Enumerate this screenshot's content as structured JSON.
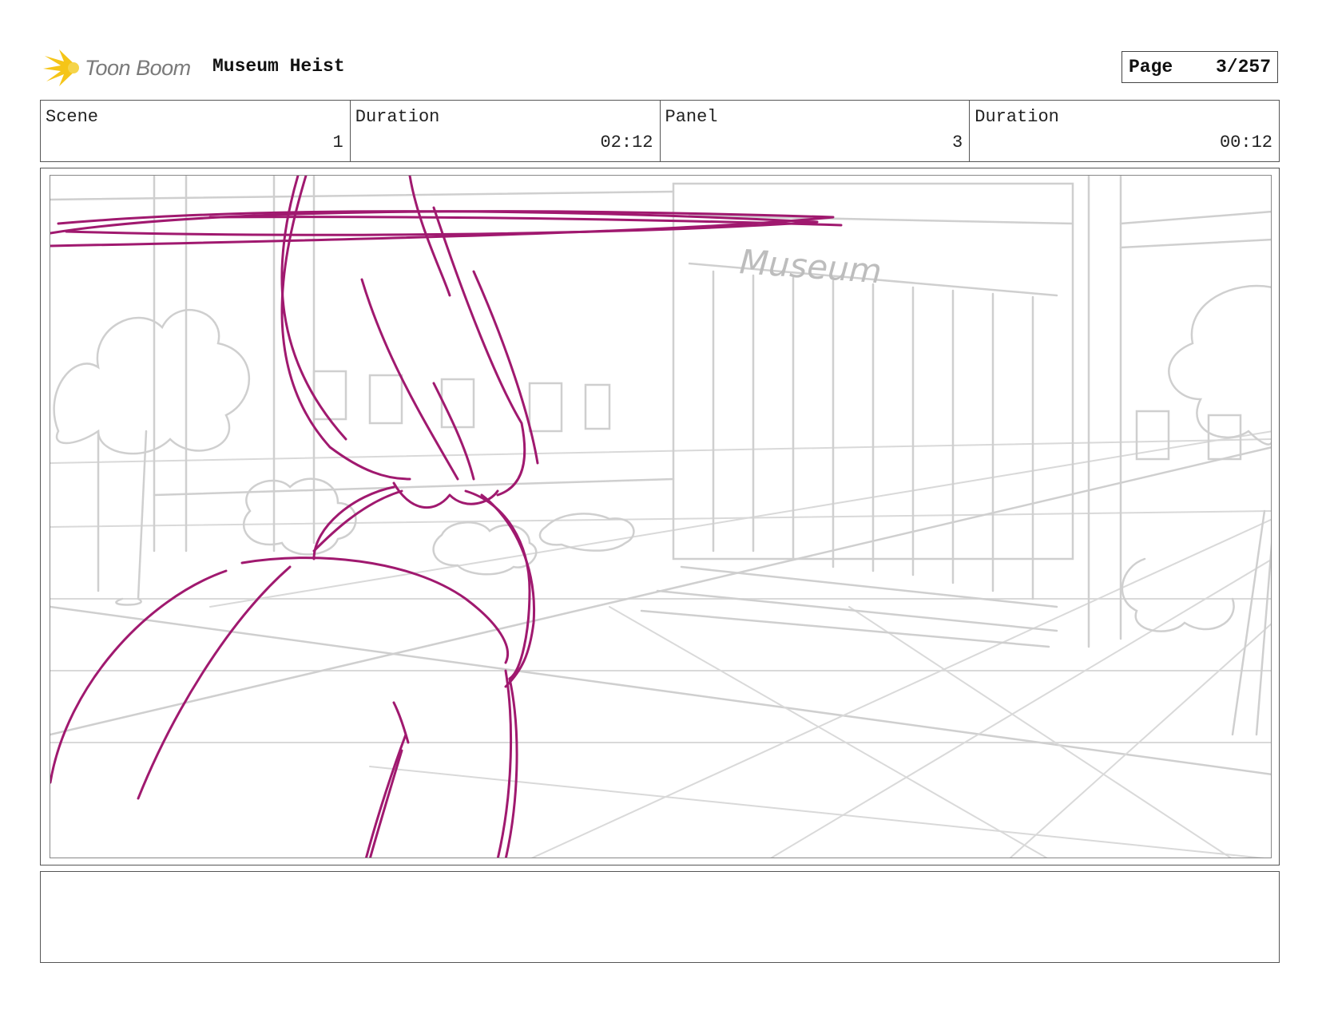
{
  "header": {
    "logo_text": "Toon Boom",
    "project_title": "Museum Heist",
    "page_label": "Page",
    "page_value": "3/257"
  },
  "info": {
    "scene_label": "Scene",
    "scene_value": "1",
    "scene_duration_label": "Duration",
    "scene_duration_value": "02:12",
    "panel_label": "Panel",
    "panel_value": "3",
    "panel_duration_label": "Duration",
    "panel_duration_value": "00:12"
  },
  "artwork": {
    "sign_text": "Museum",
    "sketch_color": "#a0196f",
    "background_color": "#cfcfcf"
  },
  "notes": {
    "text": ""
  }
}
